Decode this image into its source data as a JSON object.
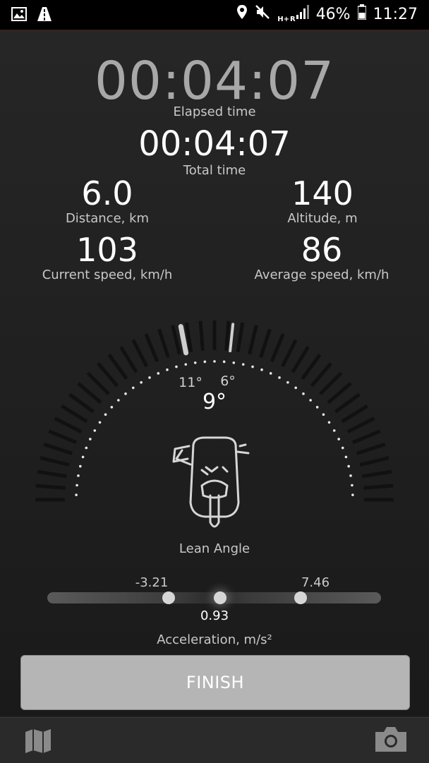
{
  "status_bar": {
    "battery": "46%",
    "time": "11:27",
    "network_top": "H+",
    "network_side": "R"
  },
  "timers": {
    "elapsed_value": "00:04:07",
    "elapsed_label": "Elapsed time",
    "total_value": "00:04:07",
    "total_label": "Total time"
  },
  "stats": {
    "distance_value": "6.0",
    "distance_label": "Distance,  km",
    "altitude_value": "140",
    "altitude_label": "Altitude,  m",
    "speed_value": "103",
    "speed_label": "Current speed,  km/h",
    "avg_speed_value": "86",
    "avg_speed_label": "Average speed,  km/h"
  },
  "lean": {
    "left_max": "11°",
    "right_max": "6°",
    "current": "9°",
    "label": "Lean Angle",
    "left_max_deg": 11,
    "right_max_deg": 6
  },
  "acceleration": {
    "min": "-3.21",
    "max": "7.46",
    "current": "0.93",
    "label": "Acceleration,  m/s²",
    "min_value": -3.21,
    "max_value": 7.46,
    "current_value": 0.93
  },
  "finish_label": "FINISH",
  "icons": {
    "status_left": [
      "image-icon",
      "road-icon"
    ],
    "status_right": [
      "location-icon",
      "mute-icon",
      "signal-icon",
      "battery-icon"
    ],
    "bottom": [
      "map-icon",
      "camera-icon"
    ]
  },
  "colors": {
    "background": "#1e1e1e",
    "finish_button": "#b5b5b5",
    "elapsed_text": "#a8a8a8"
  }
}
